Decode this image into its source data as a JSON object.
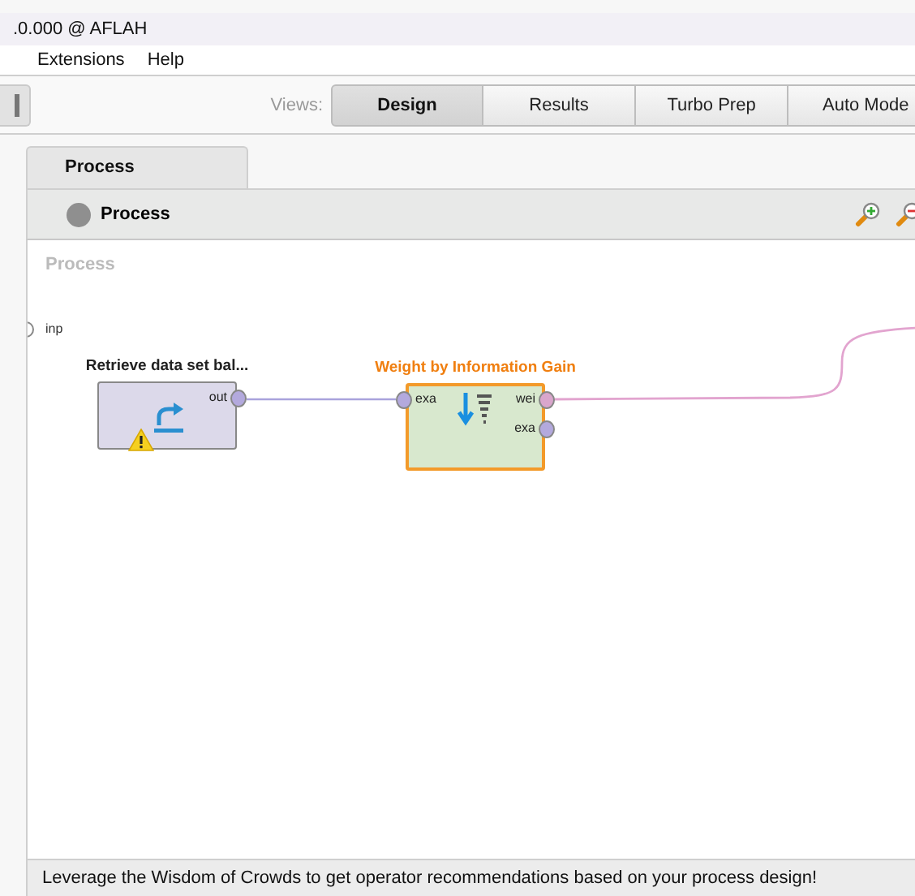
{
  "window": {
    "title": ".0.000 @ AFLAH"
  },
  "menu": [
    {
      "label": "Extensions"
    },
    {
      "label": "Help"
    }
  ],
  "toolbar": {
    "views_label": "Views:",
    "views": [
      {
        "label": "Design",
        "selected": true
      },
      {
        "label": "Results",
        "selected": false
      },
      {
        "label": "Turbo Prep",
        "selected": false
      },
      {
        "label": "Auto Mode",
        "selected": false
      }
    ]
  },
  "process_tab": {
    "label": "Process"
  },
  "breadcrumb": "Process",
  "canvas": {
    "label": "Process",
    "input_port": "inp",
    "operators": [
      {
        "kind": "retrieve",
        "name": "Retrieve data set bal...",
        "selected": false,
        "warning": true,
        "out_ports": [
          "out"
        ]
      },
      {
        "kind": "weight",
        "name": "Weight by Information Gain",
        "selected": true,
        "in_ports": [
          "exa"
        ],
        "out_ports": [
          "wei",
          "exa"
        ]
      }
    ]
  },
  "status_bar": "Leverage the Wisdom of Crowds to get operator recommendations based on your process design!"
}
